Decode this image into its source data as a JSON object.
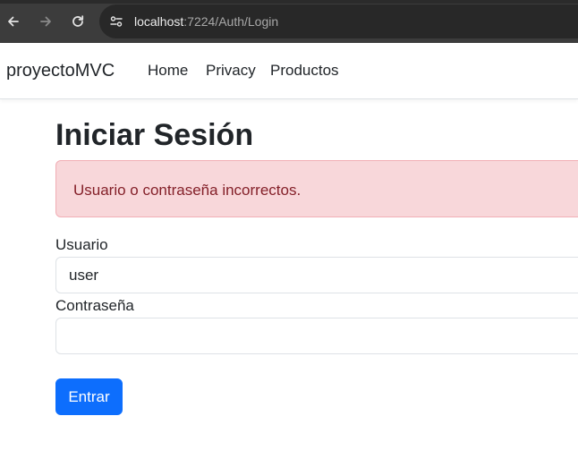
{
  "browser": {
    "url_host": "localhost",
    "url_rest": ":7224/Auth/Login",
    "icons": {
      "back": "arrow-left-icon",
      "forward": "arrow-right-icon",
      "reload": "reload-icon",
      "site_info": "site-settings-icon"
    }
  },
  "navbar": {
    "brand": "proyectoMVC",
    "links": [
      "Home",
      "Privacy",
      "Productos"
    ]
  },
  "main": {
    "title": "Iniciar Sesión",
    "alert": "Usuario o contraseña incorrectos.",
    "form": {
      "username_label": "Usuario",
      "username_value": "user",
      "password_label": "Contraseña",
      "password_value": "",
      "submit_label": "Entrar"
    }
  },
  "colors": {
    "primary": "#0d6efd",
    "alert_bg": "#f8d7da",
    "alert_border": "#f1aeb5",
    "alert_text": "#842029",
    "chrome_bg": "#3c3c3c"
  }
}
